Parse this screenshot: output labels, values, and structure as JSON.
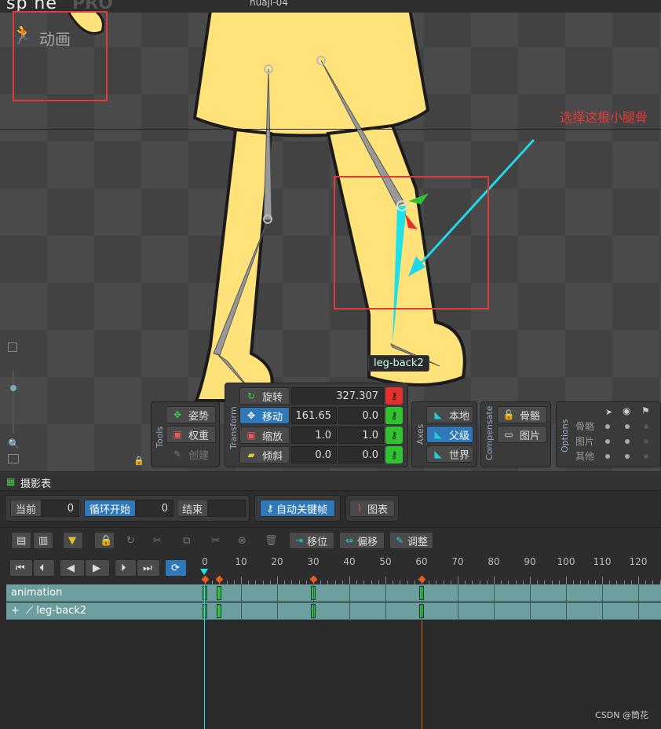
{
  "app": {
    "logo": "sp ne",
    "logo_pro": "PRO",
    "filename": "huaji-04"
  },
  "viewport": {
    "mode_label": "动画",
    "annotation": "选择这根小腿骨",
    "bone_tag": "leg-back2"
  },
  "tools": {
    "title": "Tools",
    "pose": "姿势",
    "weights": "权重",
    "create": "创建"
  },
  "transform": {
    "title": "Transform",
    "rotate": {
      "label": "旋转",
      "value": "327.307"
    },
    "translate": {
      "label": "移动",
      "x": "161.65",
      "y": "0.0"
    },
    "scale": {
      "label": "缩放",
      "x": "1.0",
      "y": "1.0"
    },
    "shear": {
      "label": "倾斜",
      "x": "0.0",
      "y": "0.0"
    }
  },
  "axes": {
    "title": "Axes",
    "local": "本地",
    "parent": "父级",
    "world": "世界"
  },
  "compensate": {
    "title": "Compensate",
    "bones": "骨骼",
    "images": "图片"
  },
  "options": {
    "title": "Options",
    "rows": [
      "骨骼",
      "图片",
      "其他"
    ]
  },
  "dopesheet": {
    "title": "摄影表",
    "current_label": "当前",
    "current_value": "0",
    "loop_start_label": "循环开始",
    "loop_start_value": "0",
    "end_label": "结束",
    "autokey": "自动关键帧",
    "graph": "图表",
    "move": "移位",
    "offset": "偏移",
    "adjust": "调整",
    "ruler": [
      "0",
      "10",
      "20",
      "30",
      "40",
      "50",
      "60",
      "70",
      "80",
      "90",
      "100",
      "110",
      "120"
    ],
    "tracks": [
      {
        "name": "animation"
      },
      {
        "name": "leg-back2"
      }
    ],
    "keyframes": [
      0,
      4,
      30,
      60
    ]
  },
  "watermark": "CSDN @筒花",
  "colors": {
    "accent": "#2f79b8",
    "key_green": "#31c231",
    "key_red": "#e53030",
    "bone_cyan": "#22e0e8",
    "track": "#6d9e9e"
  }
}
